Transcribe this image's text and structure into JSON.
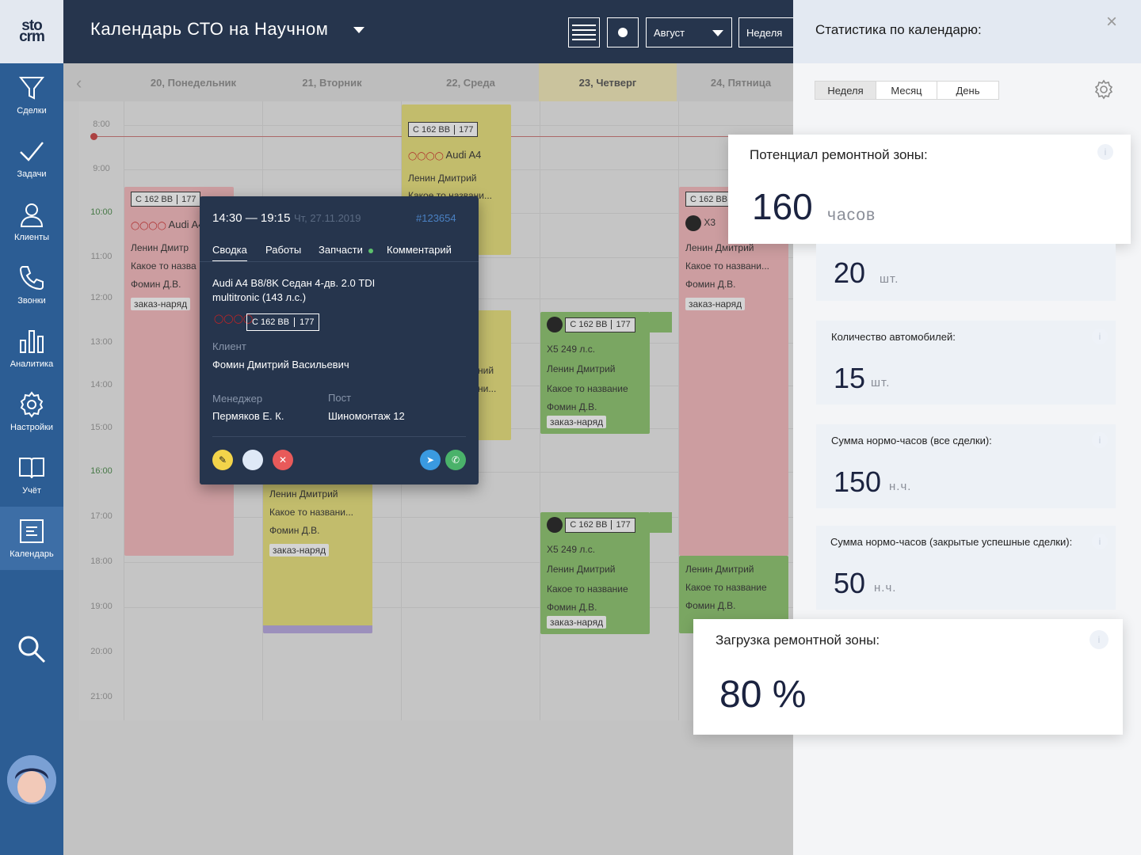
{
  "logo": {
    "line1": "sto",
    "line2": "crm"
  },
  "sidebar": {
    "items": [
      {
        "label": "Сделки"
      },
      {
        "label": "Задачи"
      },
      {
        "label": "Клиенты"
      },
      {
        "label": "Звонки"
      },
      {
        "label": "Аналитика"
      },
      {
        "label": "Настройки"
      },
      {
        "label": "Учёт"
      },
      {
        "label": "Календарь"
      }
    ]
  },
  "topbar": {
    "title": "Календарь  СТО на Научном",
    "month": "Август",
    "view": "Неделя"
  },
  "calendar": {
    "days": [
      "20, Понедельник",
      "21, Вторник",
      "22, Среда",
      "23, Четверг",
      "24, Пятница"
    ],
    "times": [
      "8:00",
      "9:00",
      "10:00",
      "11:00",
      "12:00",
      "13:00",
      "14:00",
      "15:00",
      "16:00",
      "17:00",
      "18:00",
      "19:00",
      "20:00",
      "21:00"
    ]
  },
  "events": {
    "plate_main": "С 162 ВВ",
    "plate_region": "177",
    "plate_short": "С 162 ВВ",
    "audi": "Audi A4",
    "bmw_x3": "X3",
    "bmw_x5": "X5 249 л.с.",
    "master": "Ленин Дмитрий",
    "master_cut": "Ленин Дмитр",
    "task": "Какое то названи...",
    "task_cut": "Какое то назва",
    "task_full": "Какое то название",
    "client": "Фомин Д.В.",
    "order": "заказ-наряд",
    "frag1": "ний",
    "frag2": "ни...",
    "frag3": "Какое то названи..."
  },
  "popup": {
    "time": "14:30 — 19:15",
    "date": "Чт, 27.11.2019",
    "id": "#123654",
    "tabs": [
      "Сводка",
      "Работы",
      "Запчасти",
      "Комментарий"
    ],
    "car": "Audi A4 B8/8K Седан 4-дв. 2.0 TDI",
    "car2": "multitronic (143 л.с.)",
    "plate": "С 162 ВВ",
    "region": "177",
    "client_label": "Клиент",
    "client": "Фомин Дмитрий Васильевич",
    "manager_label": "Менеджер",
    "manager": "Пермяков Е. К.",
    "post_label": "Пост",
    "post": "Шиномонтаж 12"
  },
  "panel": {
    "title": "Статистика по календарю:",
    "close": "×",
    "tabs": [
      "Неделя",
      "Месяц",
      "День"
    ],
    "cards": [
      {
        "title": "Потенциал ремонтной зоны:",
        "value": "160",
        "unit": "часов"
      },
      {
        "title": "",
        "value": "20",
        "unit": "шт."
      },
      {
        "title": "Количество автомобилей:",
        "value": "15",
        "unit": "шт."
      },
      {
        "title": "Сумма нормо-часов (все сделки):",
        "value": "150",
        "unit": "н.ч."
      },
      {
        "title": "Сумма нормо-часов (закрытые успешные сделки):",
        "value": "50",
        "unit": "н.ч."
      },
      {
        "title": "Загрузка ремонтной зоны:",
        "value": "80 %",
        "unit": ""
      }
    ]
  },
  "colors": {
    "sidebar": "#2c5d94",
    "topbar": "#26354d",
    "yellow": "#e8e07a",
    "green": "#8cc46e",
    "pink": "#f5b9bd",
    "today": "#f4ecc4"
  }
}
